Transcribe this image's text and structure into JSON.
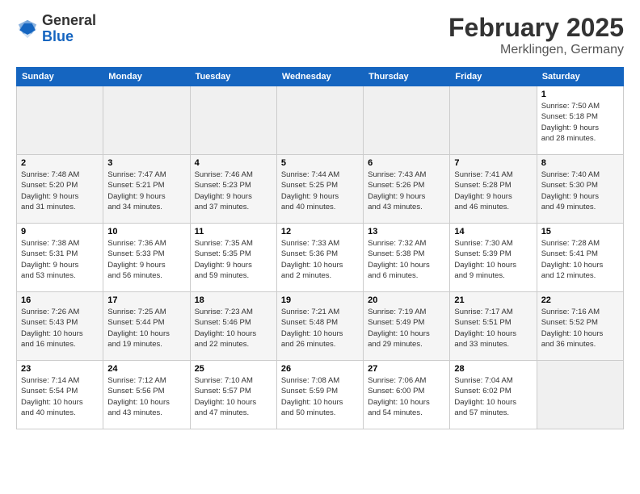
{
  "logo": {
    "general": "General",
    "blue": "Blue"
  },
  "header": {
    "month": "February 2025",
    "location": "Merklingen, Germany"
  },
  "weekdays": [
    "Sunday",
    "Monday",
    "Tuesday",
    "Wednesday",
    "Thursday",
    "Friday",
    "Saturday"
  ],
  "weeks": [
    [
      {
        "day": "",
        "info": ""
      },
      {
        "day": "",
        "info": ""
      },
      {
        "day": "",
        "info": ""
      },
      {
        "day": "",
        "info": ""
      },
      {
        "day": "",
        "info": ""
      },
      {
        "day": "",
        "info": ""
      },
      {
        "day": "1",
        "info": "Sunrise: 7:50 AM\nSunset: 5:18 PM\nDaylight: 9 hours\nand 28 minutes."
      }
    ],
    [
      {
        "day": "2",
        "info": "Sunrise: 7:48 AM\nSunset: 5:20 PM\nDaylight: 9 hours\nand 31 minutes."
      },
      {
        "day": "3",
        "info": "Sunrise: 7:47 AM\nSunset: 5:21 PM\nDaylight: 9 hours\nand 34 minutes."
      },
      {
        "day": "4",
        "info": "Sunrise: 7:46 AM\nSunset: 5:23 PM\nDaylight: 9 hours\nand 37 minutes."
      },
      {
        "day": "5",
        "info": "Sunrise: 7:44 AM\nSunset: 5:25 PM\nDaylight: 9 hours\nand 40 minutes."
      },
      {
        "day": "6",
        "info": "Sunrise: 7:43 AM\nSunset: 5:26 PM\nDaylight: 9 hours\nand 43 minutes."
      },
      {
        "day": "7",
        "info": "Sunrise: 7:41 AM\nSunset: 5:28 PM\nDaylight: 9 hours\nand 46 minutes."
      },
      {
        "day": "8",
        "info": "Sunrise: 7:40 AM\nSunset: 5:30 PM\nDaylight: 9 hours\nand 49 minutes."
      }
    ],
    [
      {
        "day": "9",
        "info": "Sunrise: 7:38 AM\nSunset: 5:31 PM\nDaylight: 9 hours\nand 53 minutes."
      },
      {
        "day": "10",
        "info": "Sunrise: 7:36 AM\nSunset: 5:33 PM\nDaylight: 9 hours\nand 56 minutes."
      },
      {
        "day": "11",
        "info": "Sunrise: 7:35 AM\nSunset: 5:35 PM\nDaylight: 9 hours\nand 59 minutes."
      },
      {
        "day": "12",
        "info": "Sunrise: 7:33 AM\nSunset: 5:36 PM\nDaylight: 10 hours\nand 2 minutes."
      },
      {
        "day": "13",
        "info": "Sunrise: 7:32 AM\nSunset: 5:38 PM\nDaylight: 10 hours\nand 6 minutes."
      },
      {
        "day": "14",
        "info": "Sunrise: 7:30 AM\nSunset: 5:39 PM\nDaylight: 10 hours\nand 9 minutes."
      },
      {
        "day": "15",
        "info": "Sunrise: 7:28 AM\nSunset: 5:41 PM\nDaylight: 10 hours\nand 12 minutes."
      }
    ],
    [
      {
        "day": "16",
        "info": "Sunrise: 7:26 AM\nSunset: 5:43 PM\nDaylight: 10 hours\nand 16 minutes."
      },
      {
        "day": "17",
        "info": "Sunrise: 7:25 AM\nSunset: 5:44 PM\nDaylight: 10 hours\nand 19 minutes."
      },
      {
        "day": "18",
        "info": "Sunrise: 7:23 AM\nSunset: 5:46 PM\nDaylight: 10 hours\nand 22 minutes."
      },
      {
        "day": "19",
        "info": "Sunrise: 7:21 AM\nSunset: 5:48 PM\nDaylight: 10 hours\nand 26 minutes."
      },
      {
        "day": "20",
        "info": "Sunrise: 7:19 AM\nSunset: 5:49 PM\nDaylight: 10 hours\nand 29 minutes."
      },
      {
        "day": "21",
        "info": "Sunrise: 7:17 AM\nSunset: 5:51 PM\nDaylight: 10 hours\nand 33 minutes."
      },
      {
        "day": "22",
        "info": "Sunrise: 7:16 AM\nSunset: 5:52 PM\nDaylight: 10 hours\nand 36 minutes."
      }
    ],
    [
      {
        "day": "23",
        "info": "Sunrise: 7:14 AM\nSunset: 5:54 PM\nDaylight: 10 hours\nand 40 minutes."
      },
      {
        "day": "24",
        "info": "Sunrise: 7:12 AM\nSunset: 5:56 PM\nDaylight: 10 hours\nand 43 minutes."
      },
      {
        "day": "25",
        "info": "Sunrise: 7:10 AM\nSunset: 5:57 PM\nDaylight: 10 hours\nand 47 minutes."
      },
      {
        "day": "26",
        "info": "Sunrise: 7:08 AM\nSunset: 5:59 PM\nDaylight: 10 hours\nand 50 minutes."
      },
      {
        "day": "27",
        "info": "Sunrise: 7:06 AM\nSunset: 6:00 PM\nDaylight: 10 hours\nand 54 minutes."
      },
      {
        "day": "28",
        "info": "Sunrise: 7:04 AM\nSunset: 6:02 PM\nDaylight: 10 hours\nand 57 minutes."
      },
      {
        "day": "",
        "info": ""
      }
    ]
  ]
}
